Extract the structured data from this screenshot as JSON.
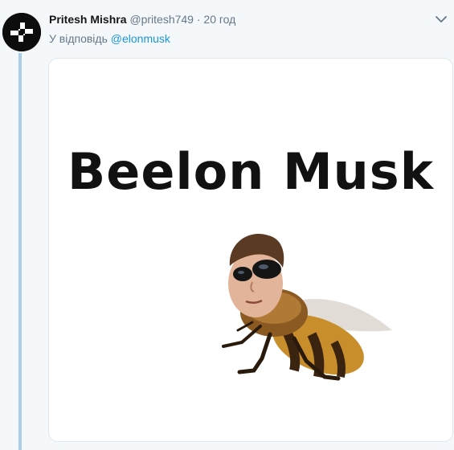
{
  "tweet": {
    "author_name": "Pritesh Mishra",
    "author_handle": "@pritesh749",
    "separator": "·",
    "time": "20 год",
    "reply_prefix": "У відповідь",
    "reply_to": "@elonmusk"
  },
  "media": {
    "meme_text": "Beelon Musk"
  },
  "icons": {
    "avatar": "avatar-logo-icon",
    "caret": "chevron-down-icon"
  },
  "colors": {
    "mention": "#1b95e0",
    "thread_line": "#a9cfe6",
    "background": "#f5f8fa"
  }
}
